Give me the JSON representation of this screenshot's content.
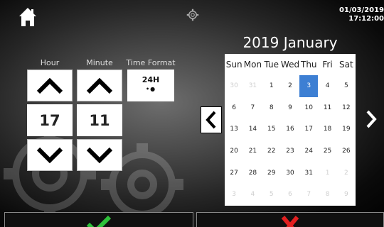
{
  "header": {
    "home_icon": "home-icon",
    "settings_icon": "gear-icon",
    "date": "01/03/2019",
    "time": "17:12:00"
  },
  "time_setting": {
    "hour_label": "Hour",
    "minute_label": "Minute",
    "format_label": "Time Format",
    "hour_value": "17",
    "minute_value": "11",
    "format_value": "24H",
    "format_indicator": "•●"
  },
  "calendar": {
    "title": "2019 January",
    "weekdays": [
      "Sun",
      "Mon",
      "Tue",
      "Wed",
      "Thu",
      "Fri",
      "Sat"
    ],
    "days": [
      {
        "d": "30",
        "muted": true
      },
      {
        "d": "31",
        "muted": true
      },
      {
        "d": "1"
      },
      {
        "d": "2"
      },
      {
        "d": "3",
        "selected": true
      },
      {
        "d": "4"
      },
      {
        "d": "5"
      },
      {
        "d": "6"
      },
      {
        "d": "7"
      },
      {
        "d": "8"
      },
      {
        "d": "9"
      },
      {
        "d": "10"
      },
      {
        "d": "11"
      },
      {
        "d": "12"
      },
      {
        "d": "13"
      },
      {
        "d": "14"
      },
      {
        "d": "15"
      },
      {
        "d": "16"
      },
      {
        "d": "17"
      },
      {
        "d": "18"
      },
      {
        "d": "19"
      },
      {
        "d": "20"
      },
      {
        "d": "21"
      },
      {
        "d": "22"
      },
      {
        "d": "23"
      },
      {
        "d": "24"
      },
      {
        "d": "25"
      },
      {
        "d": "26"
      },
      {
        "d": "27"
      },
      {
        "d": "28"
      },
      {
        "d": "29"
      },
      {
        "d": "30"
      },
      {
        "d": "31"
      },
      {
        "d": "1",
        "muted": true
      },
      {
        "d": "2",
        "muted": true
      },
      {
        "d": "3",
        "muted": true
      },
      {
        "d": "4",
        "muted": true
      },
      {
        "d": "5",
        "muted": true
      },
      {
        "d": "6",
        "muted": true
      },
      {
        "d": "7",
        "muted": true
      },
      {
        "d": "8",
        "muted": true
      },
      {
        "d": "9",
        "muted": true
      }
    ],
    "selected_color": "#3d7fd3"
  },
  "actions": {
    "confirm_icon": "checkmark-icon",
    "cancel_icon": "x-icon",
    "confirm_color": "#2ec13a",
    "cancel_color": "#e32020"
  }
}
